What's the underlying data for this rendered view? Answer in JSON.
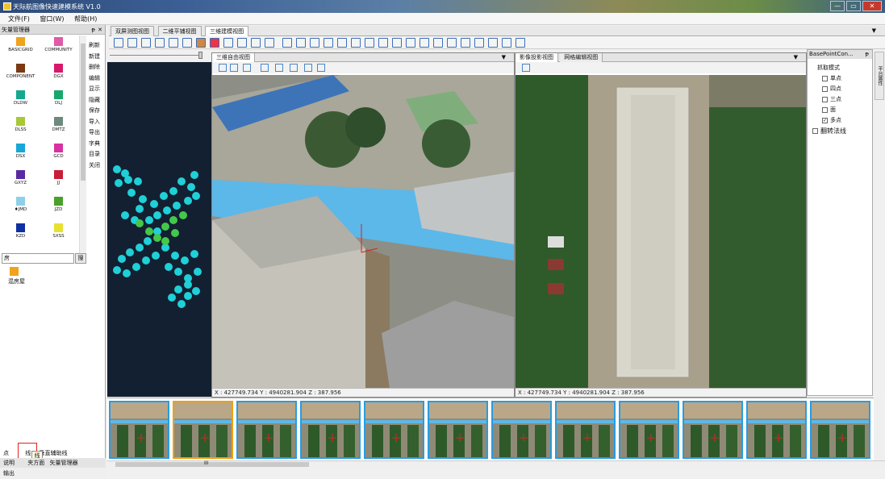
{
  "app": {
    "title": "天际航图像快速建模系统 V1.0"
  },
  "menu": [
    "文件(F)",
    "窗口(W)",
    "帮助(H)"
  ],
  "vector_panel": {
    "title": "矢量管理器",
    "swatches": [
      {
        "label": "BASICGRID",
        "color": "#f0a31c"
      },
      {
        "label": "COMMUNITY",
        "color": "#e05aa8"
      },
      {
        "label": "COMPONENT",
        "color": "#7b3a12"
      },
      {
        "label": "DGX",
        "color": "#d8196b"
      },
      {
        "label": "DLDW",
        "color": "#16a88e"
      },
      {
        "label": "DLJ",
        "color": "#18a86c"
      },
      {
        "label": "DLSS",
        "color": "#a8c838"
      },
      {
        "label": "DMTZ",
        "color": "#6a8a7c"
      },
      {
        "label": "DSX",
        "color": "#19a7d8"
      },
      {
        "label": "GCD",
        "color": "#d832a0"
      },
      {
        "label": "GXYZ",
        "color": "#5a2aa0"
      },
      {
        "label": "JJ",
        "color": "#c81c38"
      },
      {
        "label": "♦JMD",
        "color": "#8fd0e8"
      },
      {
        "label": "JZD",
        "color": "#4aa02a"
      },
      {
        "label": "KZD",
        "color": "#1030a0"
      },
      {
        "label": "SXSS",
        "color": "#e8e030"
      }
    ],
    "actions": [
      "刷新",
      "新建",
      "删除",
      "编辑",
      "显示",
      "隐藏",
      "保存",
      "导入",
      "导出",
      "字典",
      "目录",
      "关闭"
    ],
    "search_value": "房",
    "search_button": "搜",
    "results": [
      {
        "label": "混房屋",
        "color": "#f0a31c"
      }
    ],
    "bottom_tabs": [
      "点",
      "线",
      "垂直辅助线"
    ],
    "dock_tabs": [
      "说明",
      "夹方面",
      "矢量管理器"
    ],
    "tooltip": "线",
    "status": "输出"
  },
  "doc_tabs": [
    "双屏测图视图",
    "二维平铺视图",
    "三维建模视图"
  ],
  "active_doc_tab": 2,
  "view3d": {
    "tab": "三维自由视图",
    "coords": "X : 427749.734  Y : 4940281.904  Z : 387.956"
  },
  "view_image": {
    "tabs": [
      "影像投影视图",
      "网格编辑视图"
    ],
    "coords": "X : 427749.734  Y : 4940281.904  Z : 387.956"
  },
  "right_panel": {
    "title": "BasePointCon...",
    "section": "抓取模式",
    "options": [
      {
        "label": "单点",
        "checked": false
      },
      {
        "label": "四点",
        "checked": false
      },
      {
        "label": "三点",
        "checked": false
      },
      {
        "label": "面",
        "checked": false
      },
      {
        "label": "多点",
        "checked": true
      }
    ],
    "flip_normal": {
      "label": "翻转法线",
      "checked": false
    },
    "side_tab": "平台属性"
  },
  "hscroll_label": "III"
}
